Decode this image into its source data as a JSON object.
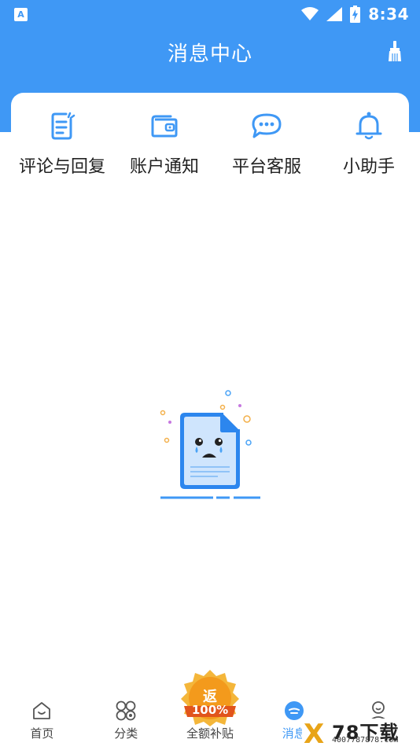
{
  "status_bar": {
    "time": "8:34",
    "left_icon_letter": "A",
    "icons": [
      "notification-a-icon",
      "wifi-icon",
      "cell-signal-icon",
      "battery-icon"
    ]
  },
  "header": {
    "title": "消息中心",
    "clear_icon": "broom-icon"
  },
  "categories": [
    {
      "label": "评论与回复",
      "icon": "comment-edit-icon"
    },
    {
      "label": "账户通知",
      "icon": "wallet-icon"
    },
    {
      "label": "平台客服",
      "icon": "chat-bubble-icon"
    },
    {
      "label": "小助手",
      "icon": "bell-icon"
    }
  ],
  "empty_state": {
    "icon": "sad-document-icon"
  },
  "tabbar": {
    "tabs": [
      {
        "label": "首页",
        "icon": "home-icon"
      },
      {
        "label": "分类",
        "icon": "category-icon"
      },
      {
        "label": "全额补贴",
        "icon": "rebate-badge-icon"
      },
      {
        "label": "消息",
        "icon": "message-icon"
      },
      {
        "label": "",
        "icon": "profile-icon"
      }
    ],
    "badge_char": "返",
    "badge_percent": "100%"
  },
  "watermark": {
    "letter": "X",
    "brand": "78下载",
    "url": "4007787878.com"
  },
  "colors": {
    "primary": "#3f98f5",
    "badge": "#f39a1c"
  }
}
